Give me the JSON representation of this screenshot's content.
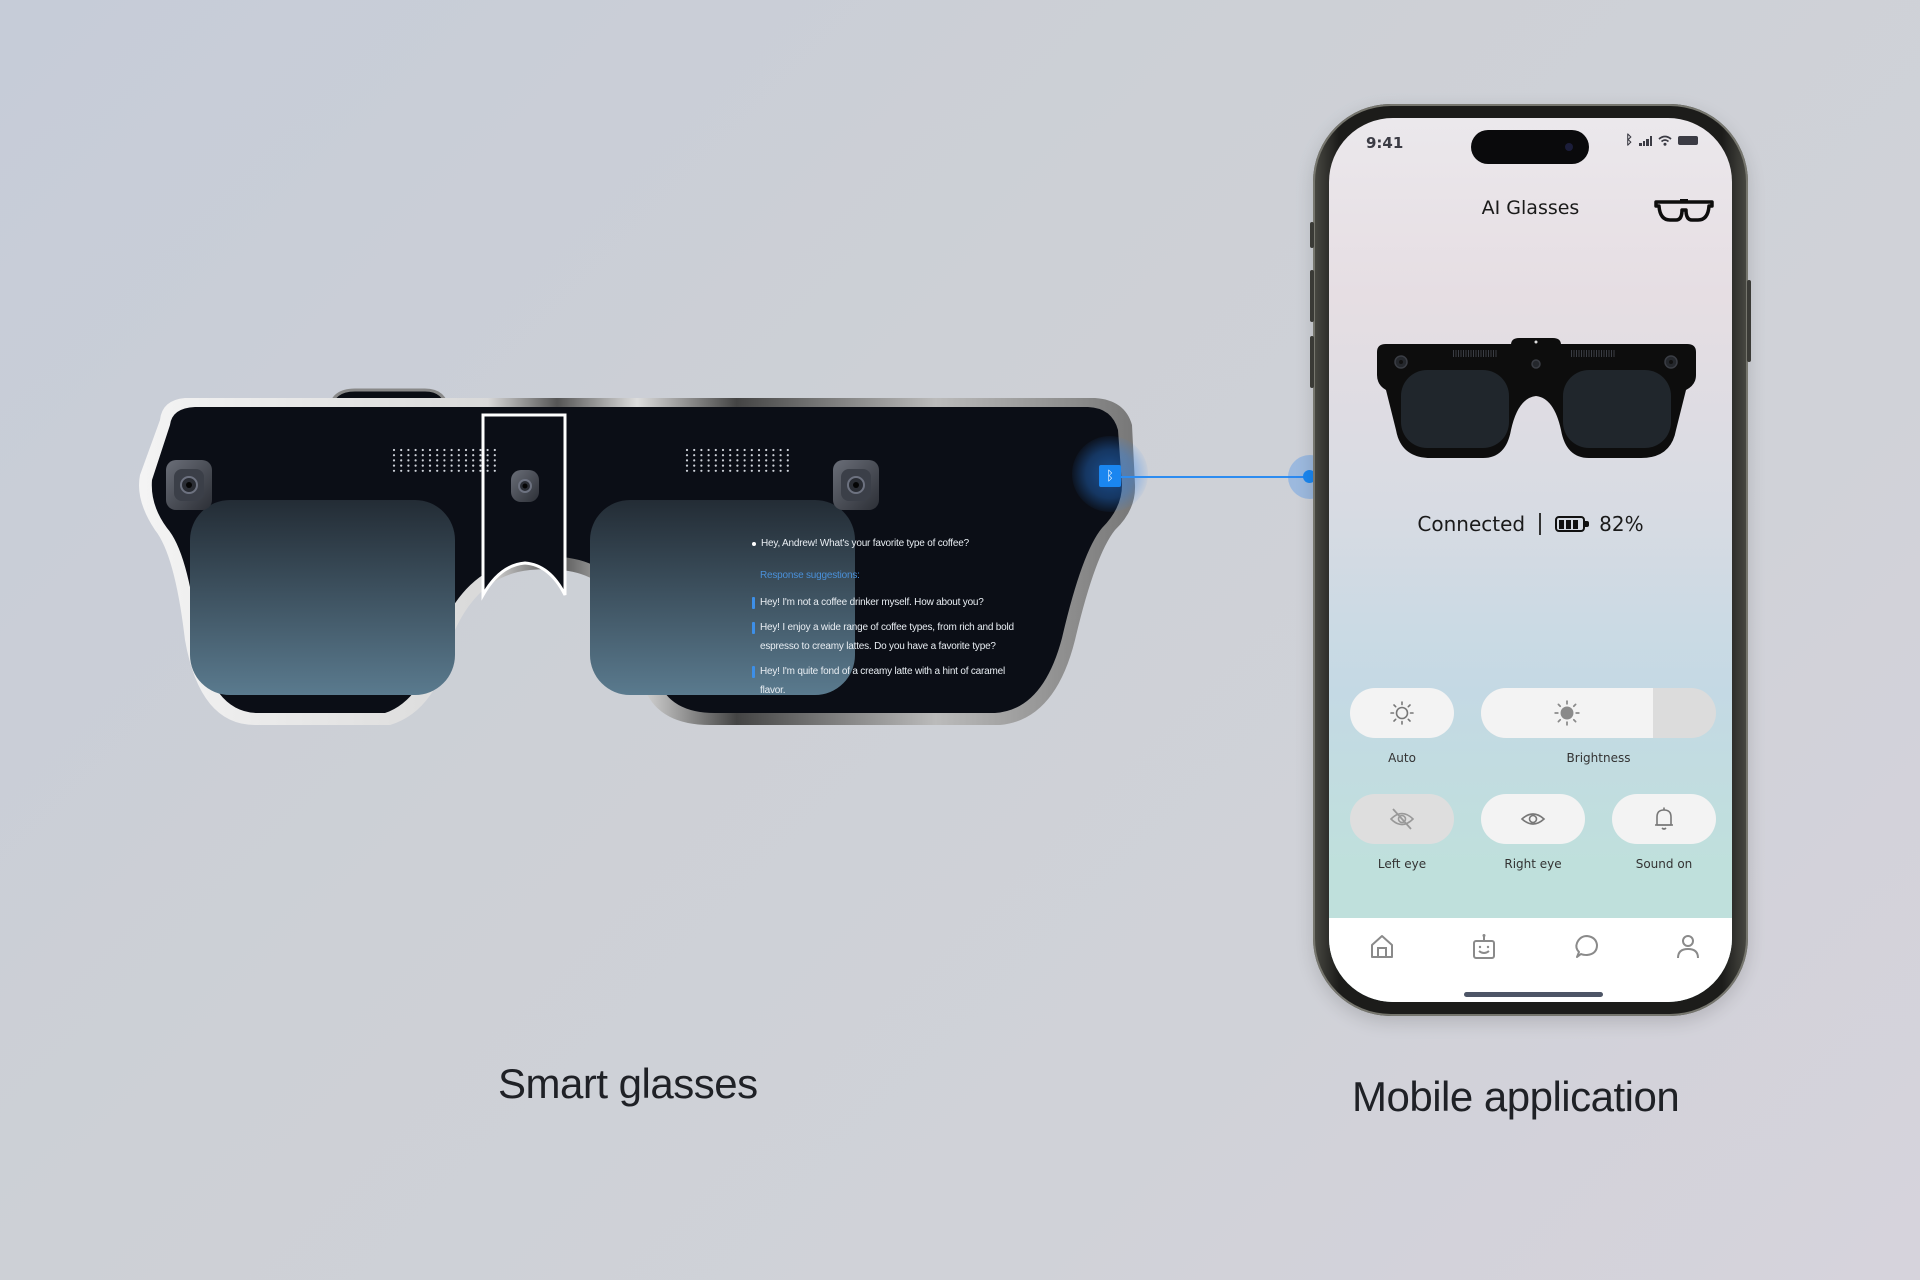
{
  "glasses_display": {
    "question": "Hey, Andrew! What's your favorite type of coffee?",
    "suggestions_title": "Response suggestions:",
    "suggestions": [
      "Hey! I'm not a coffee drinker myself. How about you?",
      "Hey! I enjoy a wide range of coffee types, from rich and bold espresso to creamy lattes. Do you have a favorite type?",
      "Hey! I'm quite fond of a creamy latte with a hint of caramel flavor."
    ],
    "connection_icon": "bluetooth-icon",
    "accent_color": "#1a86f0"
  },
  "phone": {
    "status_bar": {
      "time": "9:41",
      "icons": [
        "bluetooth-icon",
        "signal-icon",
        "wifi-icon",
        "battery-icon"
      ]
    },
    "header": {
      "title": "AI Glasses",
      "icon": "glasses-icon"
    },
    "device": {
      "status": "Connected",
      "battery_icon": "battery-icon",
      "battery_percent": "82%"
    },
    "controls": [
      {
        "label": "Auto",
        "icon": "sun-outline-icon",
        "state": "on"
      },
      {
        "label": "Brightness",
        "icon": "sun-filled-icon",
        "level": 0.73
      },
      {
        "label": "Left eye",
        "icon": "eye-off-icon",
        "state": "off"
      },
      {
        "label": "Right eye",
        "icon": "eye-icon",
        "state": "on"
      },
      {
        "label": "Sound on",
        "icon": "bell-icon",
        "state": "on"
      }
    ],
    "tabbar": [
      {
        "name": "home",
        "icon": "home-icon"
      },
      {
        "name": "assistant",
        "icon": "robot-icon"
      },
      {
        "name": "chat",
        "icon": "chat-icon"
      },
      {
        "name": "profile",
        "icon": "user-icon"
      }
    ]
  },
  "captions": {
    "left": "Smart glasses",
    "right": "Mobile application"
  }
}
